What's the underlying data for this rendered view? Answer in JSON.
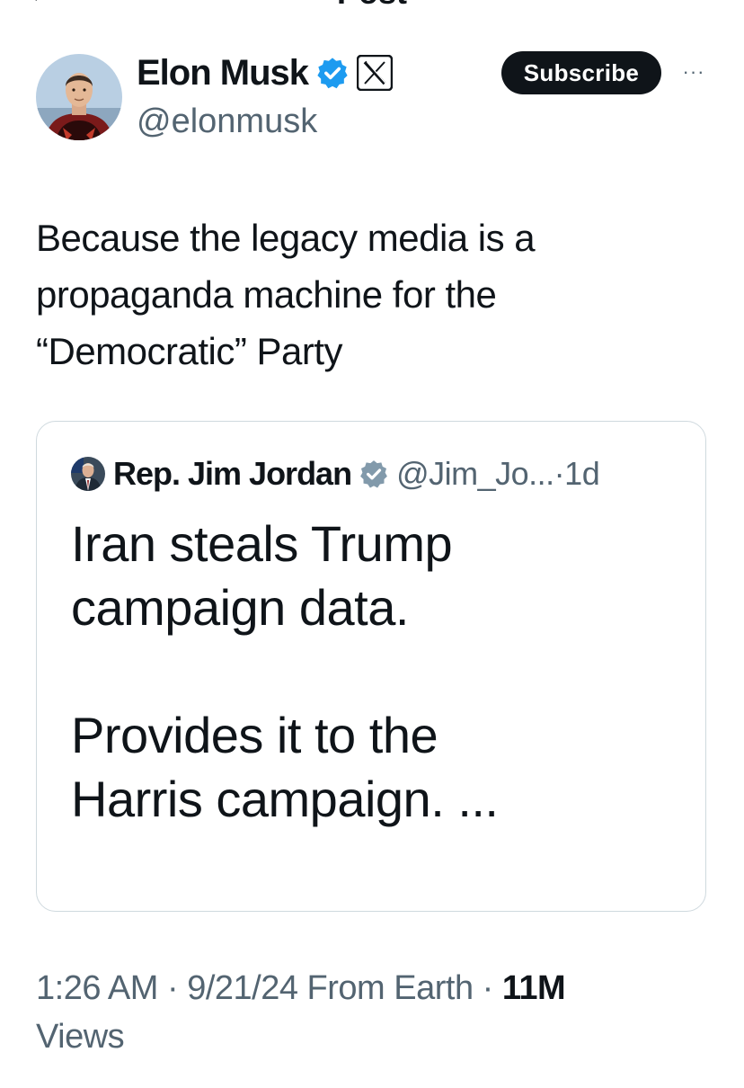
{
  "header": {
    "title": "Post",
    "back_icon": "arrow-left-icon"
  },
  "post": {
    "author_name": "Elon Musk",
    "author_handle": "@elonmusk",
    "verified_icon": "verified-badge-icon",
    "affiliation_icon": "x-logo-icon",
    "subscribe_label": "Subscribe",
    "more_label": "···",
    "text": "Because the legacy media is a\npropaganda machine for the\n“Democratic” Party",
    "time": "1:26 AM",
    "sep1": " · ",
    "date": "9/21/24",
    "location": " From Earth",
    "sep2": " · ",
    "views_count": "11M",
    "views_label": "Views"
  },
  "quote": {
    "author_name": "Rep. Jim Jordan",
    "verified_icon": "verified-badge-gray-icon",
    "author_handle": "@Jim_Jo...",
    "sep": "·",
    "time": "1d",
    "text": "Iran steals Trump\ncampaign data.\n\nProvides it to the\nHarris campaign. ..."
  },
  "colors": {
    "text_primary": "#0f1419",
    "text_secondary": "#536471",
    "verified_blue": "#1d9bf0",
    "verified_gray": "#829aab",
    "border": "#cfd9de",
    "button_dark": "#0f1419"
  }
}
